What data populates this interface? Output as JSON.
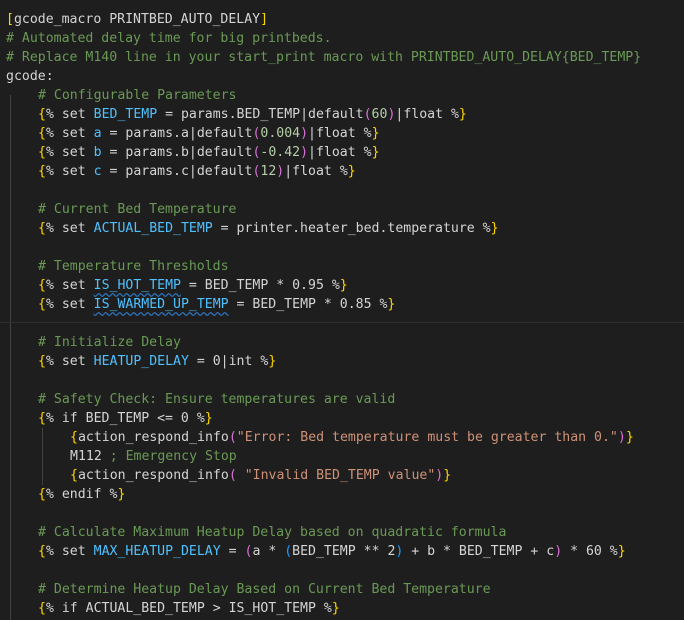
{
  "editor": {
    "language": "gcode/jinja",
    "colors": {
      "background": "#1e1e1e",
      "comment": "#6a9955",
      "bracket": "#ffd700",
      "variable": "#4fc1ff",
      "string": "#ce9178",
      "number": "#b5cea8"
    }
  },
  "code": {
    "l1_header": "gcode_macro PRINTBED_AUTO_DELAY",
    "l2_comment": "# Automated delay time for big printbeds.",
    "l3_comment": "# Replace M140 line in your start_print macro with PRINTBED_AUTO_DELAY{BED_TEMP}",
    "l4_key": "gcode:",
    "l5_comment": "# Configurable Parameters",
    "l6": {
      "set": "set",
      "var": "BED_TEMP",
      "eq": " = params.BED_TEMP|default",
      "arg": "60",
      "filt": "|float"
    },
    "l7": {
      "set": "set",
      "var": "a",
      "eq": " = params.a|default",
      "arg": "0.004",
      "filt": "|float"
    },
    "l8": {
      "set": "set",
      "var": "b",
      "eq": " = params.b|default",
      "arg": "-0.42",
      "filt": "|float"
    },
    "l9": {
      "set": "set",
      "var": "c",
      "eq": " = params.c|default",
      "arg": "12",
      "filt": "|float"
    },
    "l11_comment": "# Current Bed Temperature",
    "l12": {
      "set": "set",
      "var": "ACTUAL_BED_TEMP",
      "eq": " = printer.heater_bed.temperature"
    },
    "l14_comment": "# Temperature Thresholds",
    "l15": {
      "set": "set",
      "var": "IS_HOT_TEMP",
      "eq": " = BED_TEMP * 0.95"
    },
    "l16": {
      "set": "set",
      "var": "IS_WARMED_UP_TEMP",
      "eq": " = BED_TEMP * 0.85"
    },
    "l18_comment": "# Initialize Delay",
    "l19": {
      "set": "set",
      "var": "HEATUP_DELAY",
      "eq": " = 0|int"
    },
    "l21_comment": "# Safety Check: Ensure temperatures are valid",
    "l22": "if BED_TEMP <= 0",
    "l23": {
      "fn": "action_respond_info",
      "str": "\"Error: Bed temperature must be greater than 0.\""
    },
    "l24": {
      "cmd": "M112",
      "comment": " ; Emergency Stop"
    },
    "l25": {
      "fn": "action_respond_info",
      "pre": " ",
      "str": "\"Invalid BED_TEMP value\""
    },
    "l26": "endif",
    "l28_comment": "# Calculate Maximum Heatup Delay based on quadratic formula",
    "l29": {
      "set": "set",
      "var": "MAX_HEATUP_DELAY",
      "eq": " = ",
      "body1": "a * ",
      "body2": "BED_TEMP ** 2",
      "body3": " + b * BED_TEMP + c",
      "tail": " * 60"
    },
    "l31_comment": "# Determine Heatup Delay Based on Current Bed Temperature",
    "l32": "if ACTUAL_BED_TEMP > IS_HOT_TEMP"
  }
}
